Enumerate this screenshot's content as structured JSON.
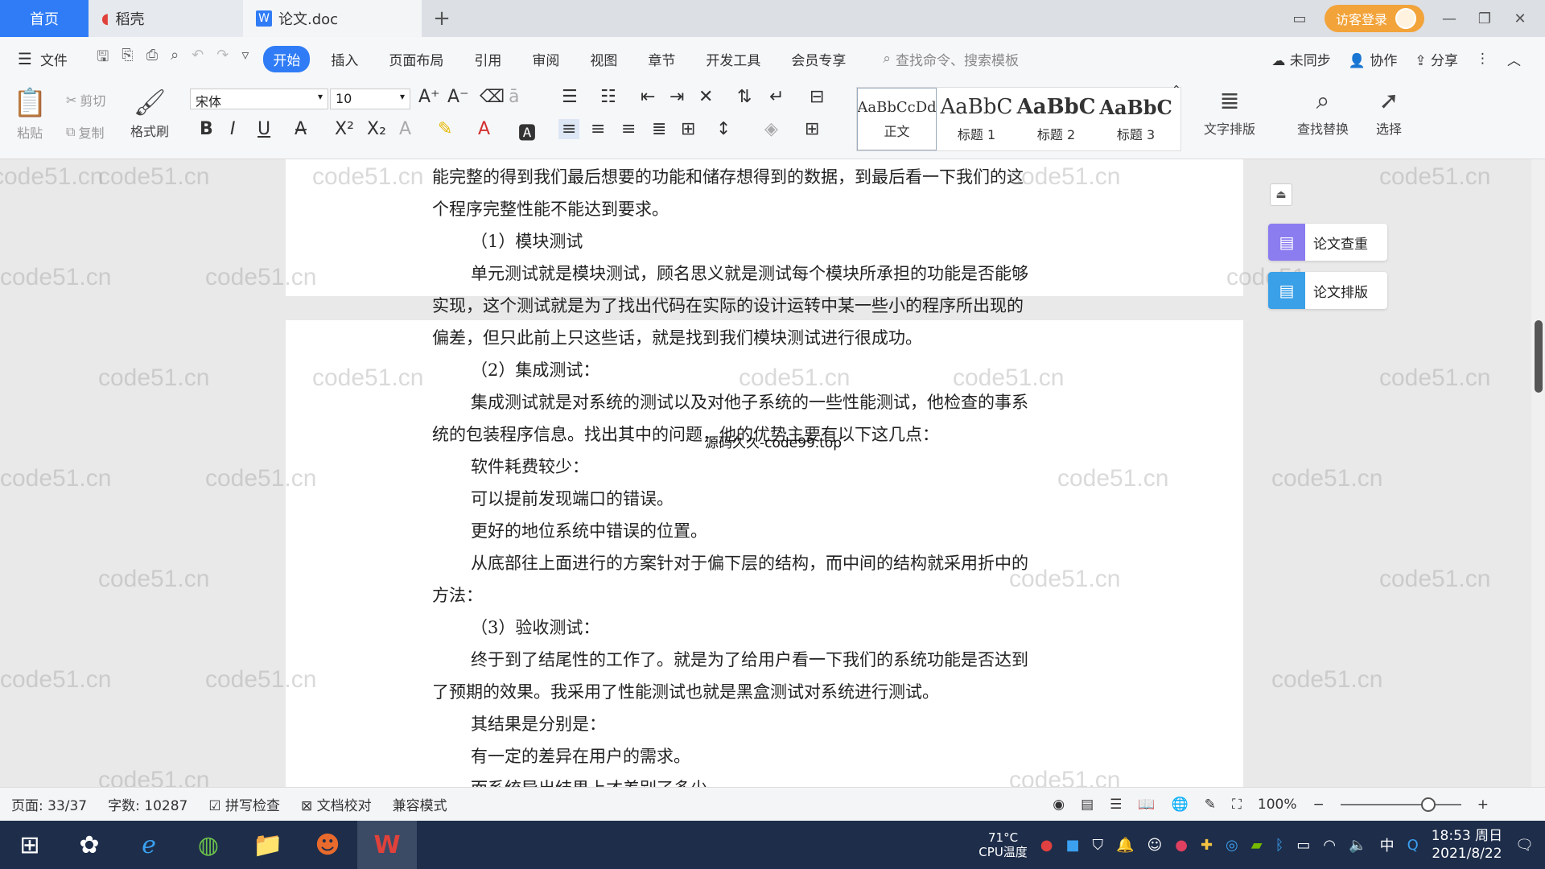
{
  "tabs": {
    "home": "首页",
    "docer": "稻壳",
    "document": "论文.doc",
    "add": "+"
  },
  "titlebar": {
    "login": "访客登录"
  },
  "menu": {
    "file": "文件",
    "items": [
      "开始",
      "插入",
      "页面布局",
      "引用",
      "审阅",
      "视图",
      "章节",
      "开发工具",
      "会员专享"
    ],
    "search_placeholder": "查找命令、搜索模板",
    "sync": "未同步",
    "collab": "协作",
    "share": "分享"
  },
  "ribbon": {
    "paste": "粘贴",
    "cut": "剪切",
    "copy": "复制",
    "format_painter": "格式刷",
    "font_name": "宋体",
    "font_size": "10",
    "styles": [
      {
        "sample": "AaBbCcDd",
        "name": "正文"
      },
      {
        "sample": "AaBbC",
        "name": "标题 1"
      },
      {
        "sample": "AaBbC",
        "name": "标题 2"
      },
      {
        "sample": "AaBbC",
        "name": "标题 3"
      }
    ],
    "text_layout": "文字排版",
    "find_replace": "查找替换",
    "select": "选择"
  },
  "document": {
    "lines": [
      {
        "text": "能完整的得到我们最后想要的功能和储存想得到的数据，到最后看一下我们的这",
        "indent": false
      },
      {
        "text": "个程序完整性能不能达到要求。",
        "indent": false
      },
      {
        "text": "（1）模块测试",
        "indent": true
      },
      {
        "text": "单元测试就是模块测试，顾名思义就是测试每个模块所承担的功能是否能够",
        "indent": true
      },
      {
        "text": "实现，这个测试就是为了找出代码在实际的设计运转中某一些小的程序所出现的",
        "indent": false
      },
      {
        "text": "偏差，但只此前上只这些话，就是找到我们模块测试进行很成功。",
        "indent": false
      },
      {
        "text": "（2）集成测试：",
        "indent": true
      },
      {
        "text": "集成测试就是对系统的测试以及对他子系统的一些性能测试，他检查的事系",
        "indent": true
      },
      {
        "text": "统的包装程序信息。找出其中的问题，他的优势主要有以下这几点：",
        "indent": false
      },
      {
        "text": "软件耗费较少：",
        "indent": true
      },
      {
        "text": "可以提前发现端口的错误。",
        "indent": true
      },
      {
        "text": "更好的地位系统中错误的位置。",
        "indent": true
      },
      {
        "text": "从底部往上面进行的方案针对于偏下层的结构，而中间的结构就采用折中的",
        "indent": true
      },
      {
        "text": "方法：",
        "indent": false
      },
      {
        "text": "（3）验收测试：",
        "indent": true
      },
      {
        "text": "终于到了结尾性的工作了。就是为了给用户看一下我们的系统功能是否达到",
        "indent": true
      },
      {
        "text": "了预期的效果。我采用了性能测试也就是黑盒测试对系统进行测试。",
        "indent": false
      },
      {
        "text": "其结果是分别是：",
        "indent": true
      },
      {
        "text": "有一定的差异在用户的需求。",
        "indent": true
      },
      {
        "text": "而系统导出结果上才差别了多少",
        "indent": true
      }
    ],
    "overlay_note": "源码久久-code99.top",
    "watermark": "code51.cn"
  },
  "side_tools": {
    "plagiarism": "论文查重",
    "formatting": "论文排版"
  },
  "status": {
    "page": "页面: 33/37",
    "words": "字数: 10287",
    "spellcheck": "拼写检查",
    "proofread": "文档校对",
    "compat": "兼容模式",
    "zoom": "100%"
  },
  "taskbar": {
    "temp": "71°C",
    "temp_label": "CPU温度",
    "ime": "中",
    "time": "18:53 周日",
    "date": "2021/8/22"
  }
}
